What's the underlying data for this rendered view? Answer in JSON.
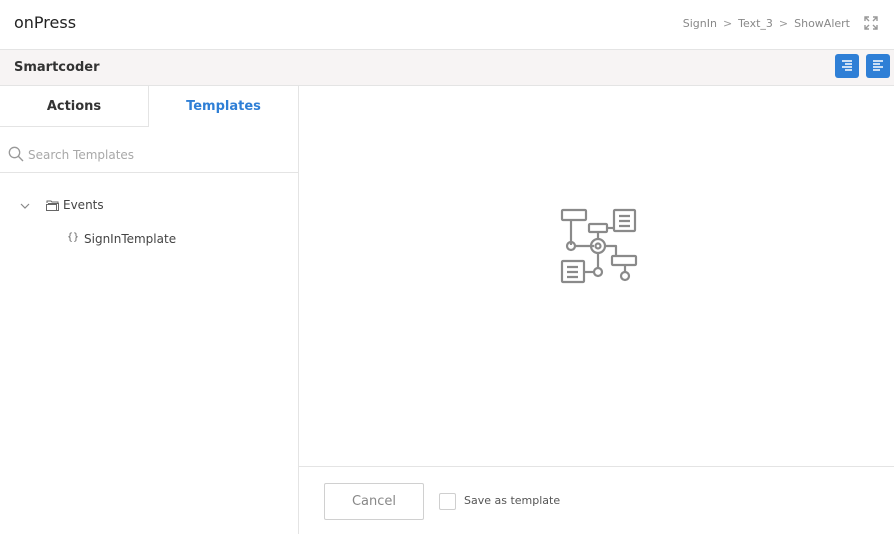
{
  "window": {
    "title": "onPress"
  },
  "breadcrumb": {
    "items": [
      "SignIn",
      "Text_3",
      "ShowAlert"
    ],
    "separator": ">"
  },
  "toolbar": {
    "title": "Smartcoder"
  },
  "tabs": {
    "actions": "Actions",
    "templates": "Templates",
    "active": "Templates"
  },
  "search": {
    "placeholder": "Search Templates",
    "value": ""
  },
  "tree": {
    "folder": {
      "label": "Events",
      "expanded": true
    },
    "items": [
      {
        "label": "SignInTemplate"
      }
    ]
  },
  "footer": {
    "cancel_label": "Cancel",
    "save_template_label": "Save as template",
    "save_template_checked": false
  },
  "icons": {
    "expand": "expand-icon",
    "align_right": "align-right-icon",
    "align_left": "align-left-icon",
    "search": "search-icon",
    "chevron": "chevron-down-icon",
    "folder": "folder-icon",
    "braces": "braces-icon",
    "flow": "flowchart-icon"
  },
  "colors": {
    "accent": "#2f7fd6",
    "toolbar_bg": "#f7f4f4",
    "border": "#e4e4e4"
  }
}
